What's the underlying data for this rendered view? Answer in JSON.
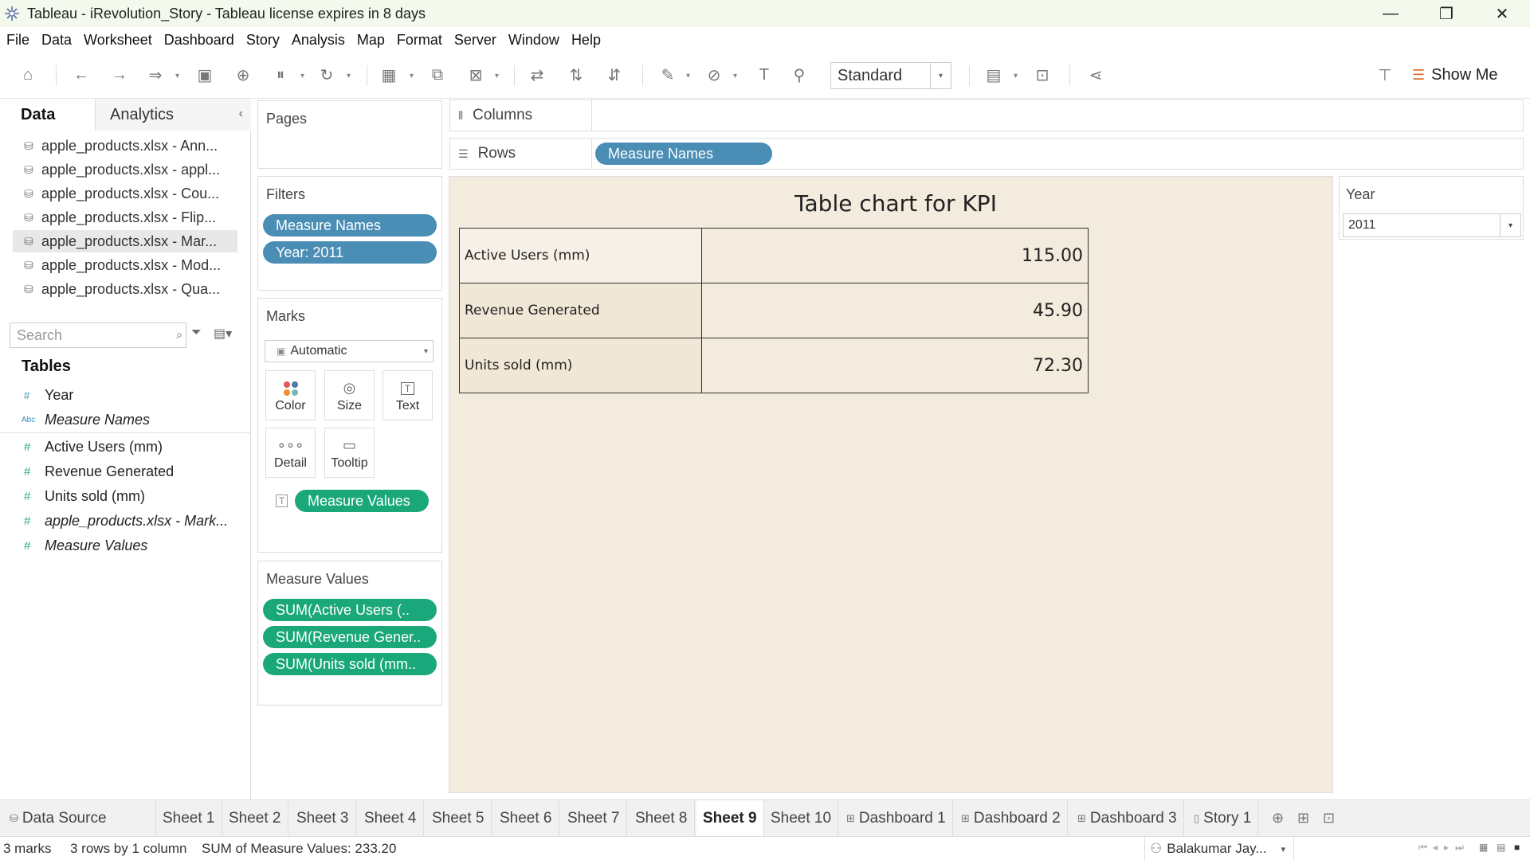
{
  "window": {
    "title": "Tableau - iRevolution_Story - Tableau license expires in 8 days",
    "minimize": "—",
    "restore": "❐",
    "close": "✕"
  },
  "menu": [
    "File",
    "Data",
    "Worksheet",
    "Dashboard",
    "Story",
    "Analysis",
    "Map",
    "Format",
    "Server",
    "Window",
    "Help"
  ],
  "toolbar": {
    "fit_value": "Standard",
    "show_me_label": "Show Me"
  },
  "data_pane": {
    "tab_data": "Data",
    "tab_analytics": "Analytics",
    "data_sources": [
      "apple_products.xlsx - Ann...",
      "apple_products.xlsx - appl...",
      "apple_products.xlsx - Cou...",
      "apple_products.xlsx - Flip...",
      "apple_products.xlsx - Mar...",
      "apple_products.xlsx - Mod...",
      "apple_products.xlsx - Qua..."
    ],
    "selected_source_index": 4,
    "search_placeholder": "Search",
    "tables_heading": "Tables",
    "fields": [
      {
        "type": "#",
        "name": "Year"
      },
      {
        "type": "Abc",
        "name": "Measure Names"
      },
      {
        "type": "#",
        "name": "Active Users (mm)"
      },
      {
        "type": "#",
        "name": "Revenue Generated"
      },
      {
        "type": "#",
        "name": "Units sold (mm)"
      },
      {
        "type": "#",
        "name": "apple_products.xlsx - Mark..."
      },
      {
        "type": "#",
        "name": "Measure Values"
      }
    ]
  },
  "pages_card": {
    "title": "Pages"
  },
  "filters_card": {
    "title": "Filters",
    "pills": [
      "Measure Names",
      "Year: 2011"
    ]
  },
  "marks_card": {
    "title": "Marks",
    "type": "Automatic",
    "buttons": [
      "Color",
      "Size",
      "Text",
      "Detail",
      "Tooltip"
    ],
    "text_pill": "Measure Values"
  },
  "measure_values_card": {
    "title": "Measure Values",
    "pills": [
      "SUM(Active Users (..",
      "SUM(Revenue Gener..",
      "SUM(Units sold (mm.."
    ]
  },
  "shelves": {
    "columns_label": "Columns",
    "rows_label": "Rows",
    "rows_pill": "Measure Names"
  },
  "view": {
    "title": "Table chart for KPI",
    "rows": [
      {
        "label": "Active Users (mm)",
        "value": "115.00"
      },
      {
        "label": "Revenue Generated",
        "value": "45.90"
      },
      {
        "label": "Units sold (mm)",
        "value": "72.30"
      }
    ]
  },
  "year_filter": {
    "title": "Year",
    "value": "2011"
  },
  "sheet_tabs": [
    {
      "label": "Data Source",
      "kind": "datasource"
    },
    {
      "label": "Sheet 1",
      "kind": "sheet"
    },
    {
      "label": "Sheet 2",
      "kind": "sheet"
    },
    {
      "label": "Sheet 3",
      "kind": "sheet"
    },
    {
      "label": "Sheet 4",
      "kind": "sheet"
    },
    {
      "label": "Sheet 5",
      "kind": "sheet"
    },
    {
      "label": "Sheet 6",
      "kind": "sheet"
    },
    {
      "label": "Sheet 7",
      "kind": "sheet"
    },
    {
      "label": "Sheet 8",
      "kind": "sheet"
    },
    {
      "label": "Sheet 9",
      "kind": "sheet",
      "active": true
    },
    {
      "label": "Sheet 10",
      "kind": "sheet"
    },
    {
      "label": "Dashboard 1",
      "kind": "dashboard"
    },
    {
      "label": "Dashboard 2",
      "kind": "dashboard"
    },
    {
      "label": "Dashboard 3",
      "kind": "dashboard"
    },
    {
      "label": "Story 1",
      "kind": "story"
    }
  ],
  "status": {
    "marks": "3 marks",
    "dims": "3 rows by 1 column",
    "sum": "SUM of Measure Values: 233.20",
    "user": "Balakumar Jay..."
  },
  "colors": {
    "dimension_pill": "#4a8db5",
    "measure_pill": "#1aa87b",
    "view_background": "#f3ebdd",
    "titlebar": "#f3f9ec"
  }
}
